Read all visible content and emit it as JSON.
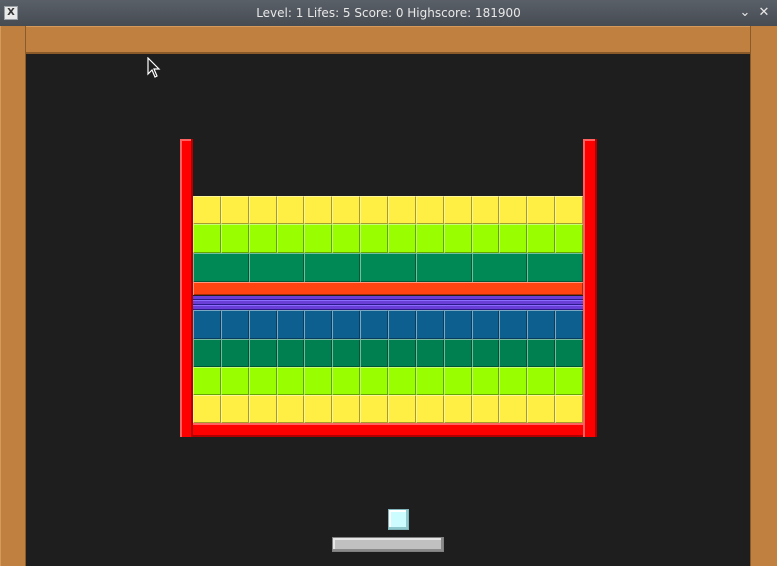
{
  "window": {
    "title": "Level: 1 Lifes: 5 Score: 0 Highscore: 181900",
    "app_icon_glyph": "X",
    "minimize_glyph": "⌄",
    "close_glyph": "✕"
  },
  "game": {
    "level": 1,
    "lifes": 5,
    "score": 0,
    "highscore": 181900
  },
  "colors": {
    "wall": "#bf8040",
    "playfield": "#1e1e1e",
    "cup": "#ff0000",
    "ball": "#ccfcff",
    "paddle": "#c0c0c0"
  },
  "brick_rows": [
    {
      "name": "yellow",
      "color": "#ffee44",
      "cols": 14
    },
    {
      "name": "lime",
      "color": "#99ff00",
      "cols": 14
    },
    {
      "name": "green",
      "color": "#008855",
      "cols": 7
    },
    {
      "name": "orange",
      "color": "#ff4411",
      "cols": 1
    },
    {
      "name": "purple",
      "color": "#6a3fd8",
      "cols": 1
    },
    {
      "name": "blue",
      "color": "#0d5f8f",
      "cols": 14
    },
    {
      "name": "teal",
      "color": "#007f50",
      "cols": 14
    },
    {
      "name": "lime-lower",
      "color": "#99ff00",
      "cols": 14
    },
    {
      "name": "yellow-lower",
      "color": "#ffee44",
      "cols": 14
    }
  ]
}
